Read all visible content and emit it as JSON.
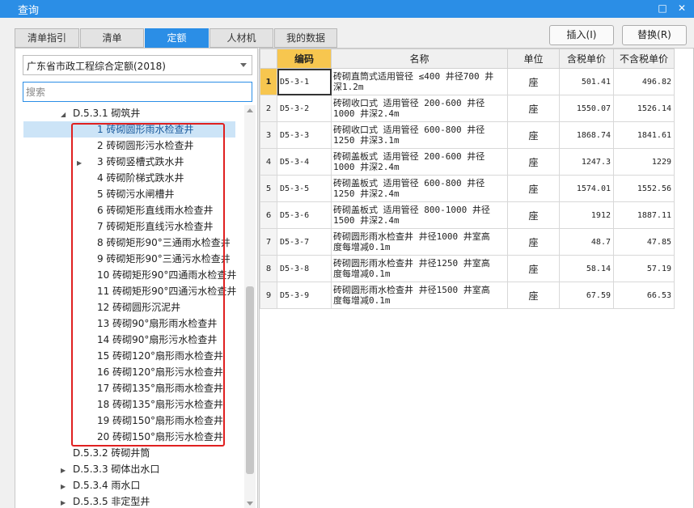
{
  "window": {
    "title": "查询"
  },
  "tabs": [
    {
      "label": "清单指引",
      "active": false
    },
    {
      "label": "清单",
      "active": false
    },
    {
      "label": "定额",
      "active": true
    },
    {
      "label": "人材机",
      "active": false
    },
    {
      "label": "我的数据",
      "active": false
    }
  ],
  "toolbar": {
    "insert_label": "插入(I)",
    "replace_label": "替换(R)"
  },
  "left": {
    "library_value": "广东省市政工程综合定额(2018)",
    "search_placeholder": "搜索",
    "tree": [
      {
        "label": "D.5.3.1 砌筑井",
        "level": 0,
        "expand": "expanded"
      },
      {
        "label": "1 砖砌圆形雨水检查井",
        "level": 1,
        "selected": true
      },
      {
        "label": "2 砖砌圆形污水检查井",
        "level": 1
      },
      {
        "label": "3 砖砌竖槽式跌水井",
        "level": 1,
        "expand": "collapsed"
      },
      {
        "label": "4 砖砌阶梯式跌水井",
        "level": 1
      },
      {
        "label": "5 砖砌污水闸槽井",
        "level": 1
      },
      {
        "label": "6 砖砌矩形直线雨水检查井",
        "level": 1
      },
      {
        "label": "7 砖砌矩形直线污水检查井",
        "level": 1
      },
      {
        "label": "8 砖砌矩形90°三通雨水检查井",
        "level": 1
      },
      {
        "label": "9 砖砌矩形90°三通污水检查井",
        "level": 1
      },
      {
        "label": "10 砖砌矩形90°四通雨水检查井",
        "level": 1
      },
      {
        "label": "11 砖砌矩形90°四通污水检查井",
        "level": 1
      },
      {
        "label": "12 砖砌圆形沉泥井",
        "level": 1
      },
      {
        "label": "13 砖砌90°扇形雨水检查井",
        "level": 1
      },
      {
        "label": "14 砖砌90°扇形污水检查井",
        "level": 1
      },
      {
        "label": "15 砖砌120°扇形雨水检查井",
        "level": 1
      },
      {
        "label": "16 砖砌120°扇形污水检查井",
        "level": 1
      },
      {
        "label": "17 砖砌135°扇形雨水检查井",
        "level": 1
      },
      {
        "label": "18 砖砌135°扇形污水检查井",
        "level": 1
      },
      {
        "label": "19 砖砌150°扇形雨水检查井",
        "level": 1
      },
      {
        "label": "20 砖砌150°扇形污水检查井",
        "level": 1
      },
      {
        "label": "D.5.3.2 砖砌井筒",
        "level": 0,
        "expand": "none"
      },
      {
        "label": "D.5.3.3 砌体出水口",
        "level": 0,
        "expand": "collapsed"
      },
      {
        "label": "D.5.3.4 雨水口",
        "level": 0,
        "expand": "collapsed"
      },
      {
        "label": "D.5.3.5 非定型井",
        "level": 0,
        "expand": "collapsed"
      }
    ]
  },
  "table": {
    "columns": [
      "",
      "编码",
      "名称",
      "单位",
      "含税单价",
      "不含税单价"
    ],
    "rows": [
      {
        "idx": "1",
        "code": "D5-3-1",
        "name1": "砖砌直筒式适用管径 ≤400 井径700 井",
        "name2": "深1.2m",
        "unit": "座",
        "price": "501.41",
        "price_ex": "496.82"
      },
      {
        "idx": "2",
        "code": "D5-3-2",
        "name1": "砖砌收口式 适用管径 200-600 井径",
        "name2": "1000 井深2.4m",
        "unit": "座",
        "price": "1550.07",
        "price_ex": "1526.14"
      },
      {
        "idx": "3",
        "code": "D5-3-3",
        "name1": "砖砌收口式 适用管径 600-800 井径",
        "name2": "1250 井深3.1m",
        "unit": "座",
        "price": "1868.74",
        "price_ex": "1841.61"
      },
      {
        "idx": "4",
        "code": "D5-3-4",
        "name1": "砖砌盖板式 适用管径 200-600 井径",
        "name2": "1000 井深2.4m",
        "unit": "座",
        "price": "1247.3",
        "price_ex": "1229"
      },
      {
        "idx": "5",
        "code": "D5-3-5",
        "name1": "砖砌盖板式 适用管径 600-800 井径",
        "name2": "1250 井深2.4m",
        "unit": "座",
        "price": "1574.01",
        "price_ex": "1552.56"
      },
      {
        "idx": "6",
        "code": "D5-3-6",
        "name1": "砖砌盖板式 适用管径 800-1000 井径",
        "name2": "1500 井深2.4m",
        "unit": "座",
        "price": "1912",
        "price_ex": "1887.11"
      },
      {
        "idx": "7",
        "code": "D5-3-7",
        "name1": "砖砌圆形雨水检查井 井径1000 井室高",
        "name2": "度每增减0.1m",
        "unit": "座",
        "price": "48.7",
        "price_ex": "47.85"
      },
      {
        "idx": "8",
        "code": "D5-3-8",
        "name1": "砖砌圆形雨水检查井 井径1250 井室高",
        "name2": "度每增减0.1m",
        "unit": "座",
        "price": "58.14",
        "price_ex": "57.19"
      },
      {
        "idx": "9",
        "code": "D5-3-9",
        "name1": "砖砌圆形雨水检查井 井径1500 井室高",
        "name2": "度每增减0.1m",
        "unit": "座",
        "price": "67.59",
        "price_ex": "66.53"
      }
    ]
  }
}
